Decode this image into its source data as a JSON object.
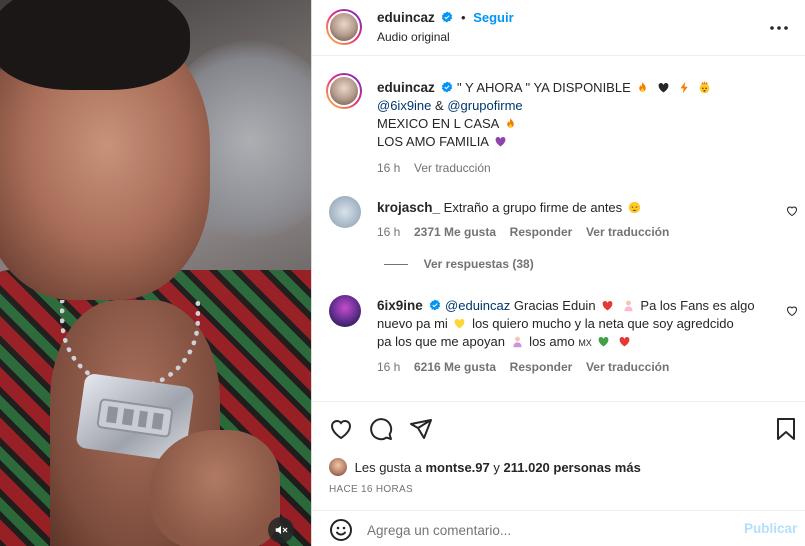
{
  "header": {
    "username": "eduincaz",
    "separator": "•",
    "follow_label": "Seguir",
    "subtitle": "Audio original",
    "more_icon": "more-horizontal-icon"
  },
  "caption": {
    "username": "eduincaz",
    "line1": "\" Y AHORA \" YA DISPONIBLE",
    "mention1": "@6ix9ine",
    "amp": " & ",
    "mention2": "@grupofirme",
    "line3": "MEXICO EN L CASA",
    "line4": "LOS AMO FAMILIA",
    "time": "16 h",
    "translate": "Ver traducción"
  },
  "comments": [
    {
      "username": "krojasch_",
      "text": "Extraño a grupo firme de antes",
      "time": "16 h",
      "likes": "2371 Me gusta",
      "reply": "Responder",
      "translate": "Ver traducción",
      "view_replies": "Ver respuestas (38)"
    },
    {
      "username": "6ix9ine",
      "mention": "@eduincaz",
      "text_a": " Gracias Eduin",
      "text_b": " Pa los Fans es algo",
      "text_c": "nuevo pa mi",
      "text_d": " los quiero mucho y la neta que soy agredcido",
      "text_e": "pa los que me apoyan",
      "text_f": " los amo ",
      "mx": "MX",
      "time": "16 h",
      "likes": "6216 Me gusta",
      "reply": "Responder",
      "translate": "Ver traducción"
    }
  ],
  "likes": {
    "prefix": "Les gusta a ",
    "user": "montse.97",
    "middle": " y ",
    "count": "211.020 personas más"
  },
  "timestamp": "HACE 16 HORAS",
  "comment_box": {
    "placeholder": "Agrega un comentario...",
    "post_label": "Publicar"
  },
  "colors": {
    "accent": "#0095f6",
    "mention": "#00376b",
    "muted": "#737373"
  }
}
